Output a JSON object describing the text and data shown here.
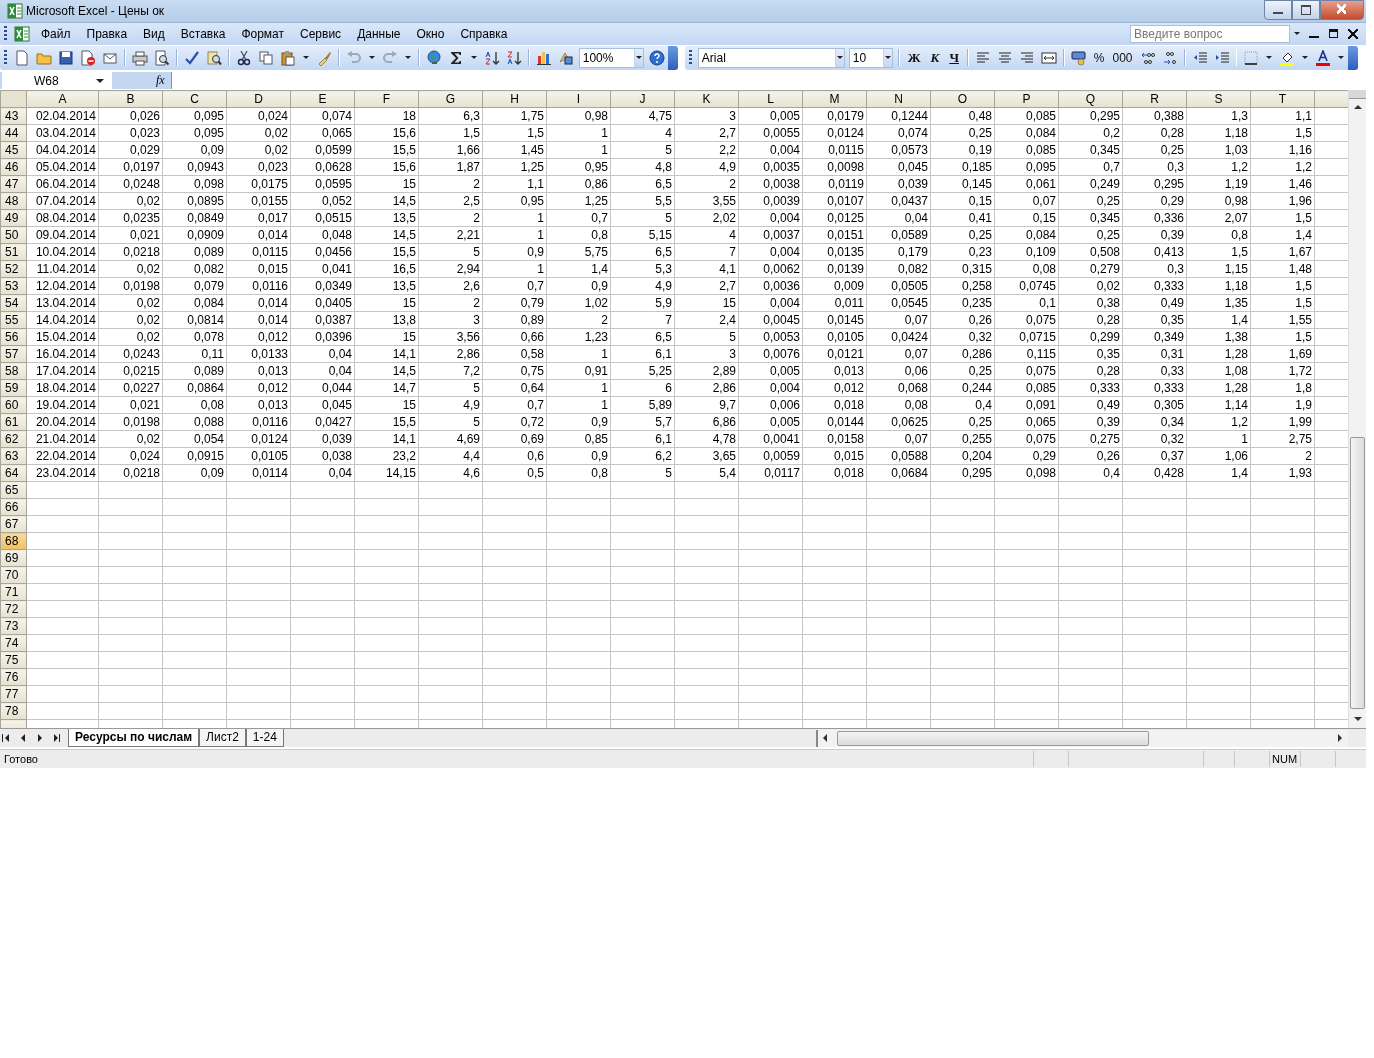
{
  "window": {
    "title": "Microsoft Excel - Цены ок"
  },
  "menu": [
    "Файл",
    "Правка",
    "Вид",
    "Вставка",
    "Формат",
    "Сервис",
    "Данные",
    "Окно",
    "Справка"
  ],
  "help_search": {
    "placeholder": "Введите вопрос"
  },
  "standard_toolbar": {
    "zoom": "100%"
  },
  "formatting_toolbar": {
    "font": "Arial",
    "size": "10",
    "bold": "Ж",
    "italic": "К",
    "underline": "Ч",
    "percent": "%",
    "thousands": "000"
  },
  "formula_bar": {
    "name_box": "W68",
    "function_label": "fx"
  },
  "sheet": {
    "columns": [
      "A",
      "B",
      "C",
      "D",
      "E",
      "F",
      "G",
      "H",
      "I",
      "J",
      "K",
      "L",
      "M",
      "N",
      "O",
      "P",
      "Q",
      "R",
      "S",
      "T"
    ],
    "rows": [
      {
        "header": "43",
        "selected": false,
        "cells": [
          "02.04.2014",
          "0,026",
          "0,095",
          "0,024",
          "0,074",
          "18",
          "6,3",
          "1,75",
          "0,98",
          "4,75",
          "3",
          "0,005",
          "0,0179",
          "0,1244",
          "0,48",
          "0,085",
          "0,295",
          "0,388",
          "1,3",
          "1,1"
        ]
      },
      {
        "header": "44",
        "selected": false,
        "cells": [
          "03.04.2014",
          "0,023",
          "0,095",
          "0,02",
          "0,065",
          "15,6",
          "1,5",
          "1,5",
          "1",
          "4",
          "2,7",
          "0,0055",
          "0,0124",
          "0,074",
          "0,25",
          "0,084",
          "0,2",
          "0,28",
          "1,18",
          "1,5"
        ]
      },
      {
        "header": "45",
        "selected": false,
        "cells": [
          "04.04.2014",
          "0,029",
          "0,09",
          "0,02",
          "0,0599",
          "15,5",
          "1,66",
          "1,45",
          "1",
          "5",
          "2,2",
          "0,004",
          "0,0115",
          "0,0573",
          "0,19",
          "0,085",
          "0,345",
          "0,25",
          "1,03",
          "1,16"
        ]
      },
      {
        "header": "46",
        "selected": false,
        "cells": [
          "05.04.2014",
          "0,0197",
          "0,0943",
          "0,023",
          "0,0628",
          "15,6",
          "1,87",
          "1,25",
          "0,95",
          "4,8",
          "4,9",
          "0,0035",
          "0,0098",
          "0,045",
          "0,185",
          "0,095",
          "0,7",
          "0,3",
          "1,2",
          "1,2"
        ]
      },
      {
        "header": "47",
        "selected": false,
        "cells": [
          "06.04.2014",
          "0,0248",
          "0,098",
          "0,0175",
          "0,0595",
          "15",
          "2",
          "1,1",
          "0,86",
          "6,5",
          "2",
          "0,0038",
          "0,0119",
          "0,039",
          "0,145",
          "0,061",
          "0,249",
          "0,295",
          "1,19",
          "1,46"
        ]
      },
      {
        "header": "48",
        "selected": false,
        "cells": [
          "07.04.2014",
          "0,02",
          "0,0895",
          "0,0155",
          "0,052",
          "14,5",
          "2,5",
          "0,95",
          "1,25",
          "5,5",
          "3,55",
          "0,0039",
          "0,0107",
          "0,0437",
          "0,15",
          "0,07",
          "0,25",
          "0,29",
          "0,98",
          "1,96"
        ]
      },
      {
        "header": "49",
        "selected": false,
        "cells": [
          "08.04.2014",
          "0,0235",
          "0,0849",
          "0,017",
          "0,0515",
          "13,5",
          "2",
          "1",
          "0,7",
          "5",
          "2,02",
          "0,004",
          "0,0125",
          "0,04",
          "0,41",
          "0,15",
          "0,345",
          "0,336",
          "2,07",
          "1,5"
        ]
      },
      {
        "header": "50",
        "selected": false,
        "cells": [
          "09.04.2014",
          "0,021",
          "0,0909",
          "0,014",
          "0,048",
          "14,5",
          "2,21",
          "1",
          "0,8",
          "5,15",
          "4",
          "0,0037",
          "0,0151",
          "0,0589",
          "0,25",
          "0,084",
          "0,25",
          "0,39",
          "0,8",
          "1,4"
        ]
      },
      {
        "header": "51",
        "selected": false,
        "cells": [
          "10.04.2014",
          "0,0218",
          "0,089",
          "0,0115",
          "0,0456",
          "15,5",
          "5",
          "0,9",
          "5,75",
          "6,5",
          "7",
          "0,004",
          "0,0135",
          "0,179",
          "0,23",
          "0,109",
          "0,508",
          "0,413",
          "1,5",
          "1,67"
        ]
      },
      {
        "header": "52",
        "selected": false,
        "cells": [
          "11.04.2014",
          "0,02",
          "0,082",
          "0,015",
          "0,041",
          "16,5",
          "2,94",
          "1",
          "1,4",
          "5,3",
          "4,1",
          "0,0062",
          "0,0139",
          "0,082",
          "0,315",
          "0,08",
          "0,279",
          "0,3",
          "1,15",
          "1,48"
        ]
      },
      {
        "header": "53",
        "selected": false,
        "cells": [
          "12.04.2014",
          "0,0198",
          "0,079",
          "0,0116",
          "0,0349",
          "13,5",
          "2,6",
          "0,7",
          "0,9",
          "4,9",
          "2,7",
          "0,0036",
          "0,009",
          "0,0505",
          "0,258",
          "0,0745",
          "0,02",
          "0,333",
          "1,18",
          "1,5"
        ]
      },
      {
        "header": "54",
        "selected": false,
        "cells": [
          "13.04.2014",
          "0,02",
          "0,084",
          "0,014",
          "0,0405",
          "15",
          "2",
          "0,79",
          "1,02",
          "5,9",
          "15",
          "0,004",
          "0,011",
          "0,0545",
          "0,235",
          "0,1",
          "0,38",
          "0,49",
          "1,35",
          "1,5"
        ]
      },
      {
        "header": "55",
        "selected": false,
        "cells": [
          "14.04.2014",
          "0,02",
          "0,0814",
          "0,014",
          "0,0387",
          "13,8",
          "3",
          "0,89",
          "2",
          "7",
          "2,4",
          "0,0045",
          "0,0145",
          "0,07",
          "0,26",
          "0,075",
          "0,28",
          "0,35",
          "1,4",
          "1,55"
        ]
      },
      {
        "header": "56",
        "selected": false,
        "cells": [
          "15.04.2014",
          "0,02",
          "0,078",
          "0,012",
          "0,0396",
          "15",
          "3,56",
          "0,66",
          "1,23",
          "6,5",
          "5",
          "0,0053",
          "0,0105",
          "0,0424",
          "0,32",
          "0,0715",
          "0,299",
          "0,349",
          "1,38",
          "1,5"
        ]
      },
      {
        "header": "57",
        "selected": false,
        "cells": [
          "16.04.2014",
          "0,0243",
          "0,11",
          "0,0133",
          "0,04",
          "14,1",
          "2,86",
          "0,58",
          "1",
          "6,1",
          "3",
          "0,0076",
          "0,0121",
          "0,07",
          "0,286",
          "0,115",
          "0,35",
          "0,31",
          "1,28",
          "1,69"
        ]
      },
      {
        "header": "58",
        "selected": false,
        "cells": [
          "17.04.2014",
          "0,0215",
          "0,089",
          "0,013",
          "0,04",
          "14,5",
          "7,2",
          "0,75",
          "0,91",
          "5,25",
          "2,89",
          "0,005",
          "0,013",
          "0,06",
          "0,25",
          "0,075",
          "0,28",
          "0,33",
          "1,08",
          "1,72"
        ]
      },
      {
        "header": "59",
        "selected": false,
        "cells": [
          "18.04.2014",
          "0,0227",
          "0,0864",
          "0,012",
          "0,044",
          "14,7",
          "5",
          "0,64",
          "1",
          "6",
          "2,86",
          "0,004",
          "0,012",
          "0,068",
          "0,244",
          "0,085",
          "0,333",
          "0,333",
          "1,28",
          "1,8"
        ]
      },
      {
        "header": "60",
        "selected": false,
        "cells": [
          "19.04.2014",
          "0,021",
          "0,08",
          "0,013",
          "0,045",
          "15",
          "4,9",
          "0,7",
          "1",
          "5,89",
          "9,7",
          "0,006",
          "0,018",
          "0,08",
          "0,4",
          "0,091",
          "0,49",
          "0,305",
          "1,14",
          "1,9"
        ]
      },
      {
        "header": "61",
        "selected": false,
        "cells": [
          "20.04.2014",
          "0,0198",
          "0,088",
          "0,0116",
          "0,0427",
          "15,5",
          "5",
          "0,72",
          "0,9",
          "5,7",
          "6,86",
          "0,005",
          "0,0144",
          "0,0625",
          "0,25",
          "0,065",
          "0,39",
          "0,34",
          "1,2",
          "1,99"
        ]
      },
      {
        "header": "62",
        "selected": false,
        "cells": [
          "21.04.2014",
          "0,02",
          "0,054",
          "0,0124",
          "0,039",
          "14,1",
          "4,69",
          "0,69",
          "0,85",
          "6,1",
          "4,78",
          "0,0041",
          "0,0158",
          "0,07",
          "0,255",
          "0,075",
          "0,275",
          "0,32",
          "1",
          "2,75"
        ]
      },
      {
        "header": "63",
        "selected": false,
        "cells": [
          "22.04.2014",
          "0,024",
          "0,0915",
          "0,0105",
          "0,038",
          "23,2",
          "4,4",
          "0,6",
          "0,9",
          "6,2",
          "3,65",
          "0,0059",
          "0,015",
          "0,0588",
          "0,204",
          "0,29",
          "0,26",
          "0,37",
          "1,06",
          "2"
        ]
      },
      {
        "header": "64",
        "selected": false,
        "cells": [
          "23.04.2014",
          "0,0218",
          "0,09",
          "0,0114",
          "0,04",
          "14,15",
          "4,6",
          "0,5",
          "0,8",
          "5",
          "5,4",
          "0,0117",
          "0,018",
          "0,0684",
          "0,295",
          "0,098",
          "0,4",
          "0,428",
          "1,4",
          "1,93"
        ]
      },
      {
        "header": "65",
        "selected": false
      },
      {
        "header": "66",
        "selected": false
      },
      {
        "header": "67",
        "selected": false
      },
      {
        "header": "68",
        "selected": true
      },
      {
        "header": "69",
        "selected": false
      },
      {
        "header": "70",
        "selected": false
      },
      {
        "header": "71",
        "selected": false
      },
      {
        "header": "72",
        "selected": false
      },
      {
        "header": "73",
        "selected": false
      },
      {
        "header": "74",
        "selected": false
      },
      {
        "header": "75",
        "selected": false
      },
      {
        "header": "76",
        "selected": false
      },
      {
        "header": "77",
        "selected": false
      },
      {
        "header": "78",
        "selected": false
      }
    ]
  },
  "sheet_tabs": [
    {
      "label": "Ресурсы по числам",
      "selected": true
    },
    {
      "label": "Лист2",
      "selected": false
    },
    {
      "label": "1-24",
      "selected": false
    }
  ],
  "status_bar": {
    "text": "Готово",
    "num_lock": "NUM"
  }
}
